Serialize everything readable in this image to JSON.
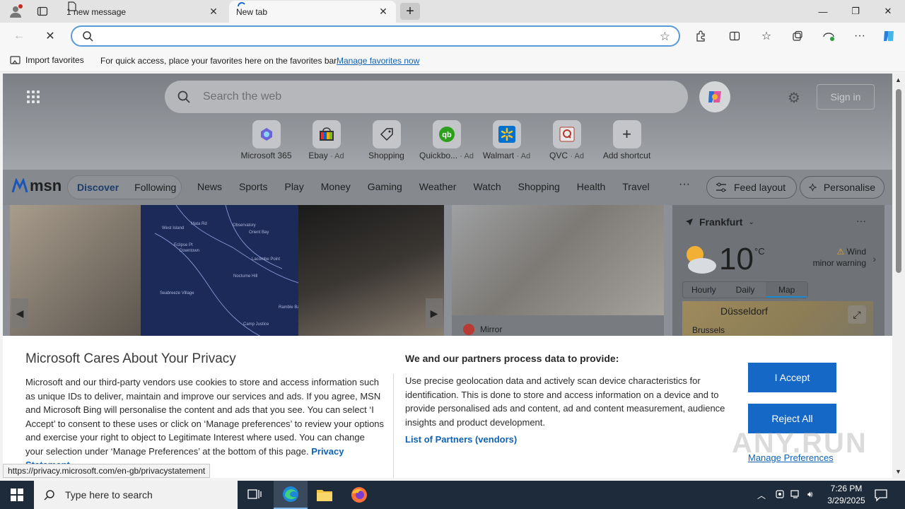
{
  "browser": {
    "tabs": [
      {
        "label": "1 new message"
      },
      {
        "label": "New tab"
      }
    ],
    "address": {
      "value": "",
      "placeholder": ""
    },
    "favorites_bar": {
      "import_label": "Import favorites",
      "message": "For quick access, place your favorites here on the favorites bar.",
      "link": "Manage favorites now"
    }
  },
  "hero": {
    "search_placeholder": "Search the web",
    "sign_in": "Sign in",
    "shortcuts": [
      {
        "label": "Microsoft 365",
        "ad": ""
      },
      {
        "label": "Ebay",
        "ad": "· Ad"
      },
      {
        "label": "Shopping",
        "ad": ""
      },
      {
        "label": "Quickbo...",
        "ad": "· Ad"
      },
      {
        "label": "Walmart",
        "ad": "· Ad"
      },
      {
        "label": "QVC",
        "ad": "· Ad"
      },
      {
        "label": "Add shortcut",
        "ad": ""
      }
    ]
  },
  "msn": {
    "logo": "msn",
    "discover": "Discover",
    "following": "Following",
    "nav": [
      "News",
      "Sports",
      "Play",
      "Money",
      "Gaming",
      "Weather",
      "Watch",
      "Shopping",
      "Health",
      "Travel"
    ],
    "more": "···",
    "feed_layout": "Feed layout",
    "personalise": "Personalise"
  },
  "cards": {
    "source": "Mirror",
    "map_labels": [
      "West Island",
      "Mata Rd",
      "Eclipse Pt",
      "Downtown",
      "Observatory",
      "Orient Bay",
      "Seabreeze Village",
      "Lacombe Point",
      "Nocturne Hill",
      "Ramble Bay",
      "Camp Justice"
    ]
  },
  "weather": {
    "city": "Frankfurt",
    "temp": "10",
    "unit": "°C",
    "warning_line1": "Wind",
    "warning_line2": "minor warning",
    "tabs": [
      "Hourly",
      "Daily",
      "Map"
    ],
    "active_tab": "Map",
    "map_city1": "Düsseldorf",
    "map_city2": "Brussels"
  },
  "privacy": {
    "title": "Microsoft Cares About Your Privacy",
    "body": "Microsoft and our third-party vendors use cookies to store and access information such as unique IDs to deliver, maintain and improve our services and ads. If you agree, MSN and Microsoft Bing will personalise the content and ads that you see. You can select ‘I Accept’ to consent to these uses or click on ‘Manage preferences’ to review your options and exercise your right to object to Legitimate Interest where used.  You can change your selection under ‘Manage Preferences’ at the bottom of this page.",
    "privacy_link": "Privacy Statement",
    "heading2": "We and our partners process data to provide:",
    "body2": "Use precise geolocation data and actively scan device characteristics for identification. This is done to store and access information on a device and to provide personalised ads and content, ad and content measurement, audience insights and product development.",
    "partners": "List of Partners (vendors)",
    "accept": "I Accept",
    "reject": "Reject All",
    "manage": "Manage Preferences"
  },
  "status_url": "https://privacy.microsoft.com/en-gb/privacystatement",
  "watermark": "ANY.RUN",
  "taskbar": {
    "search_placeholder": "Type here to search",
    "time": "7:26 PM",
    "date": "3/29/2025"
  },
  "colors": {
    "accent": "#1668c6",
    "link": "#0f62b3",
    "taskbar": "#1d2b3a"
  }
}
